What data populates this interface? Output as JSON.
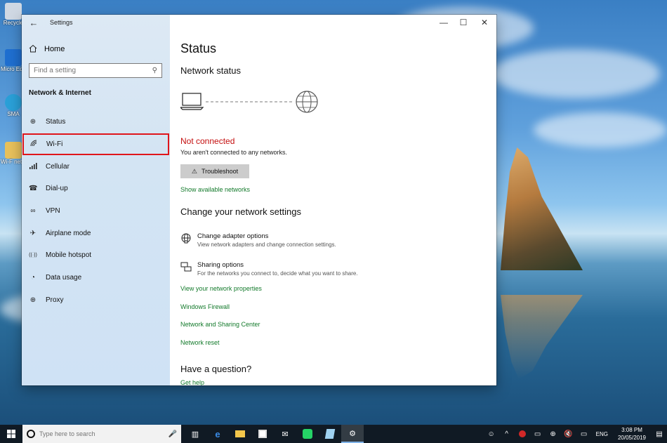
{
  "desktop": {
    "icons": [
      {
        "label": "Recycle",
        "color": "#cfd8e3"
      },
      {
        "label": "Micro Edg",
        "color": "#1f6fd0"
      },
      {
        "label": "SMA",
        "color": "#2aa0d8"
      },
      {
        "label": "Wi-F netw",
        "color": "#e8c15c"
      }
    ]
  },
  "window": {
    "title": "Settings",
    "controls": {
      "minimize": "—",
      "maximize": "☐",
      "close": "✕"
    }
  },
  "sidebar": {
    "home_label": "Home",
    "search_placeholder": "Find a setting",
    "section_title": "Network & Internet",
    "items": [
      {
        "label": "Status",
        "icon": "globe-icon",
        "glyph": "⊕"
      },
      {
        "label": "Wi-Fi",
        "icon": "wifi-icon",
        "glyph": "◜"
      },
      {
        "label": "Cellular",
        "icon": "cellular-icon",
        "glyph": "▂"
      },
      {
        "label": "Dial-up",
        "icon": "dialup-icon",
        "glyph": "☎"
      },
      {
        "label": "VPN",
        "icon": "vpn-icon",
        "glyph": "∞"
      },
      {
        "label": "Airplane mode",
        "icon": "airplane-icon",
        "glyph": "✈"
      },
      {
        "label": "Mobile hotspot",
        "icon": "hotspot-icon",
        "glyph": "((·))"
      },
      {
        "label": "Data usage",
        "icon": "data-usage-icon",
        "glyph": "◔"
      },
      {
        "label": "Proxy",
        "icon": "proxy-globe-icon",
        "glyph": "⊕"
      }
    ]
  },
  "content": {
    "page_title": "Status",
    "network_status_heading": "Network status",
    "status_text": "Not connected",
    "status_subtext": "You aren't connected to any networks.",
    "troubleshoot_label": "Troubleshoot",
    "show_networks_link": "Show available networks",
    "change_heading": "Change your network settings",
    "options": [
      {
        "title": "Change adapter options",
        "desc": "View network adapters and change connection settings."
      },
      {
        "title": "Sharing options",
        "desc": "For the networks you connect to, decide what you want to share."
      }
    ],
    "links": [
      "View your network properties",
      "Windows Firewall",
      "Network and Sharing Center",
      "Network reset"
    ],
    "question_heading": "Have a question?",
    "get_help_link": "Get help"
  },
  "taskbar": {
    "search_placeholder": "Type here to search",
    "lang": "ENG",
    "time": "3:08 PM",
    "date": "20/05/2019"
  },
  "colors": {
    "accent_link": "#137a2b",
    "error": "#c40f0f",
    "selection_outline": "#e0151b"
  }
}
